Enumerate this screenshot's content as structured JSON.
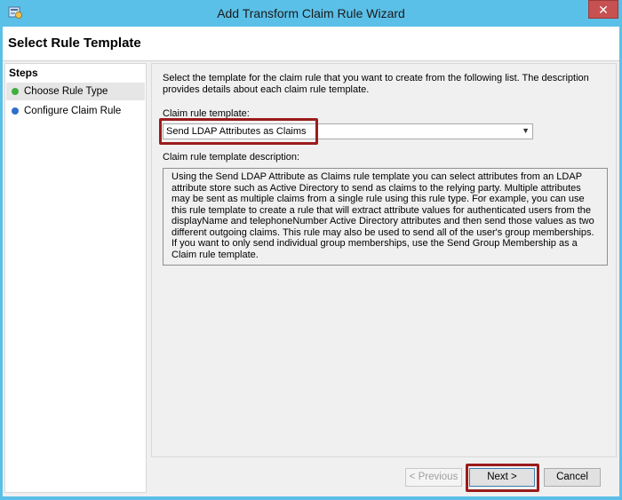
{
  "window": {
    "title": "Add Transform Claim Rule Wizard",
    "close_glyph": "✕"
  },
  "header": {
    "title": "Select Rule Template"
  },
  "steps": {
    "title": "Steps",
    "items": [
      {
        "label": "Choose Rule Type",
        "color": "#3fb03f"
      },
      {
        "label": "Configure Claim Rule",
        "color": "#2f6fc9"
      }
    ]
  },
  "content": {
    "intro": "Select the template for the claim rule that you want to create from the following list. The description provides details about each claim rule template.",
    "template_label": "Claim rule template:",
    "template_value": "Send LDAP Attributes as Claims",
    "description_label": "Claim rule template description:",
    "description": "Using the Send LDAP Attribute as Claims rule template you can select attributes from an LDAP attribute store such as Active Directory to send as claims to the relying party. Multiple attributes may be sent as multiple claims from a single rule using this rule type. For example, you can use this rule template to create a rule that will extract attribute values for authenticated users from the displayName and telephoneNumber Active Directory attributes and then send those values as two different outgoing claims. This rule may also be used to send all of the user's group memberships. If you want to only send individual group memberships, use the Send Group Membership as a Claim rule template."
  },
  "buttons": {
    "previous": "< Previous",
    "next": "Next >",
    "cancel": "Cancel"
  },
  "colors": {
    "titlebar": "#5bc0e8",
    "highlight": "#9b1c1c"
  }
}
